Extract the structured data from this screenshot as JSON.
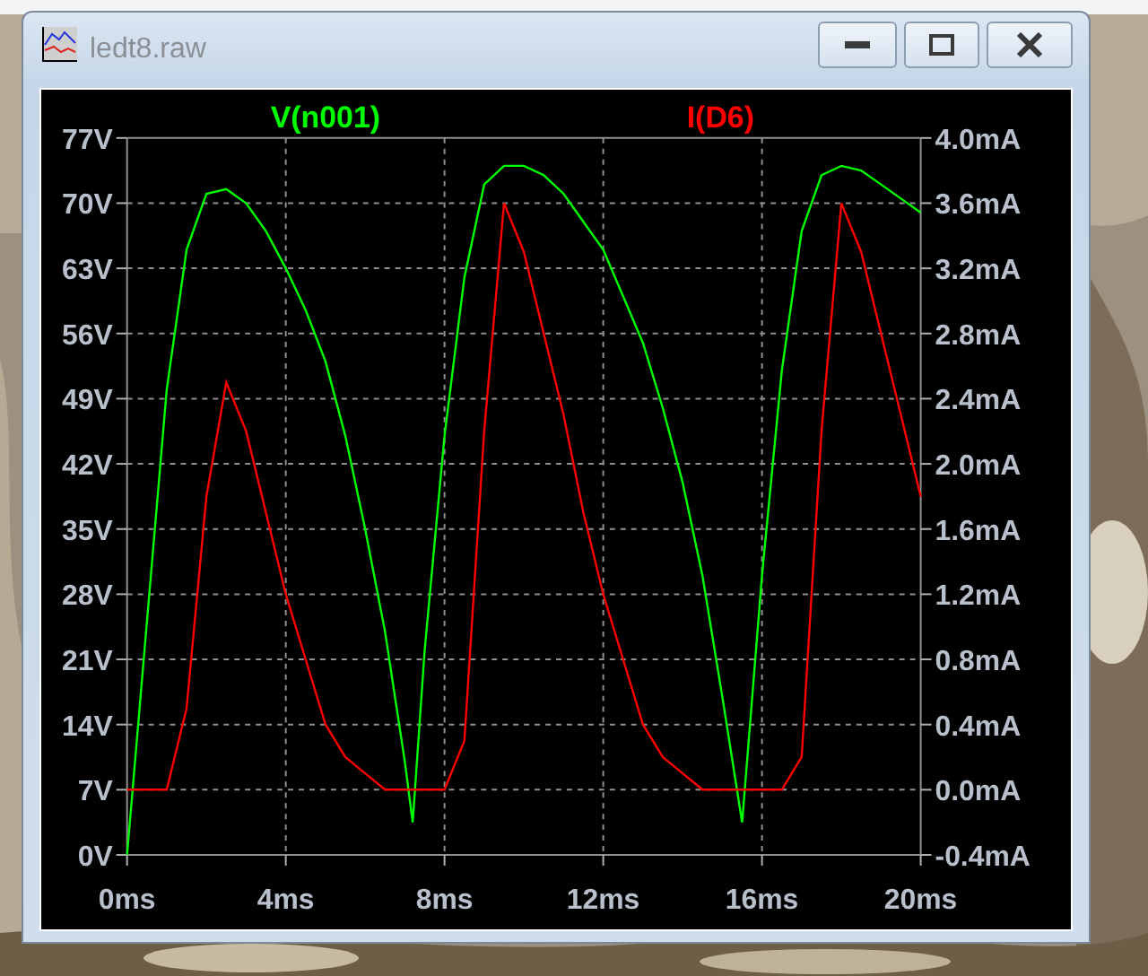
{
  "window": {
    "title": "ledt8.raw",
    "active": false
  },
  "plot": {
    "chart_data": {
      "type": "line",
      "x": [
        0,
        0.5,
        1,
        1.5,
        2,
        2.5,
        3,
        3.5,
        4,
        4.5,
        5,
        5.5,
        6,
        6.5,
        7,
        7.2,
        7.5,
        8,
        8.5,
        9,
        9.5,
        10,
        10.5,
        11,
        11.5,
        12,
        12.5,
        13,
        13.5,
        14,
        14.5,
        15,
        15.5,
        16,
        16.5,
        17,
        17.5,
        18,
        18.5,
        19,
        19.5,
        20
      ],
      "series": [
        {
          "name": "V(n001)",
          "color": "#00ff00",
          "axis": "y",
          "values": [
            0,
            25,
            50,
            65,
            71,
            71.5,
            70,
            67,
            63,
            58.5,
            53,
            45,
            35,
            24,
            10,
            3.5,
            22,
            45,
            62,
            72,
            74,
            74,
            73,
            71,
            68,
            65,
            60,
            55,
            48,
            40,
            30,
            17,
            3.5,
            30,
            52,
            67,
            73,
            74,
            73.5,
            72,
            70.5,
            69
          ]
        },
        {
          "name": "I(D6)",
          "color": "#ff0000",
          "axis": "y2",
          "values": [
            0,
            0,
            0,
            0.5,
            1.8,
            2.5,
            2.2,
            1.7,
            1.2,
            0.8,
            0.4,
            0.2,
            0.1,
            0,
            0,
            0,
            0,
            0,
            0.3,
            2.2,
            3.6,
            3.3,
            2.8,
            2.3,
            1.7,
            1.2,
            0.8,
            0.4,
            0.2,
            0.1,
            0,
            0,
            0,
            0,
            0,
            0.2,
            2.2,
            3.6,
            3.3,
            2.8,
            2.3,
            1.8
          ]
        }
      ],
      "grid": true,
      "xlim": [
        0,
        20
      ],
      "ylim": [
        0,
        77
      ],
      "y2lim": [
        -0.4,
        4.0
      ],
      "xticks": [
        {
          "value": 0,
          "label": "0ms"
        },
        {
          "value": 4,
          "label": "4ms"
        },
        {
          "value": 8,
          "label": "8ms"
        },
        {
          "value": 12,
          "label": "12ms"
        },
        {
          "value": 16,
          "label": "16ms"
        },
        {
          "value": 20,
          "label": "20ms"
        }
      ],
      "yticks": [
        {
          "value": 77,
          "label": "77V"
        },
        {
          "value": 70,
          "label": "70V"
        },
        {
          "value": 63,
          "label": "63V"
        },
        {
          "value": 56,
          "label": "56V"
        },
        {
          "value": 49,
          "label": "49V"
        },
        {
          "value": 42,
          "label": "42V"
        },
        {
          "value": 35,
          "label": "35V"
        },
        {
          "value": 28,
          "label": "28V"
        },
        {
          "value": 21,
          "label": "21V"
        },
        {
          "value": 14,
          "label": "14V"
        },
        {
          "value": 7,
          "label": "7V"
        },
        {
          "value": 0,
          "label": "0V"
        }
      ],
      "y2ticks": [
        {
          "value": 4.0,
          "label": "4.0mA"
        },
        {
          "value": 3.6,
          "label": "3.6mA"
        },
        {
          "value": 3.2,
          "label": "3.2mA"
        },
        {
          "value": 2.8,
          "label": "2.8mA"
        },
        {
          "value": 2.4,
          "label": "2.4mA"
        },
        {
          "value": 2.0,
          "label": "2.0mA"
        },
        {
          "value": 1.6,
          "label": "1.6mA"
        },
        {
          "value": 1.2,
          "label": "1.2mA"
        },
        {
          "value": 0.8,
          "label": "0.8mA"
        },
        {
          "value": 0.4,
          "label": "0.4mA"
        },
        {
          "value": 0.0,
          "label": "0.0mA"
        },
        {
          "value": -0.4,
          "label": "-0.4mA"
        }
      ]
    }
  }
}
